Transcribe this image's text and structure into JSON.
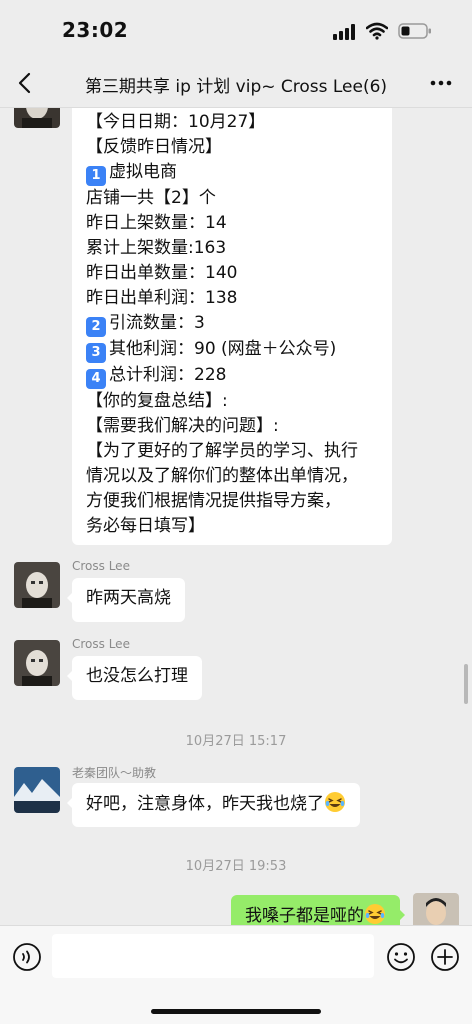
{
  "status_bar": {
    "time": "23:02"
  },
  "header": {
    "title": "第三期共享 ip 计划 vip~ Cross Lee(6)"
  },
  "messages": {
    "m1": {
      "lines": [
        "【今日日期：10月27】",
        "【反馈昨日情况】",
        "虚拟电商",
        "店铺一共【2】个",
        "昨日上架数量：14",
        "累计上架数量:163",
        "昨日出单数量：140",
        "昨日出单利润：138",
        "引流数量：3",
        "其他利润：90 (网盘＋公众号)",
        "总计利润：228",
        "【你的复盘总结】:",
        "【需要我们解决的问题】:",
        "【为了更好的了解学员的学习、执行",
        "情况以及了解你们的整体出单情况，",
        "方便我们根据情况提供指导方案，",
        "务必每日填写】"
      ],
      "badges": [
        "1",
        "2",
        "3",
        "4"
      ]
    },
    "m2": {
      "sender": "Cross Lee",
      "text": "昨两天高烧"
    },
    "m3": {
      "sender": "Cross Lee",
      "text": "也没怎么打理"
    },
    "ts1": "10月27日 15:17",
    "m4": {
      "sender": "老秦团队～助教",
      "text": "好吧，注意身体，昨天我也烧了",
      "emoji": "laughing-face"
    },
    "ts2": "10月27日 19:53",
    "m5": {
      "text": "我嗓子都是哑的",
      "emoji": "laughing-face"
    }
  },
  "input": {
    "placeholder": ""
  },
  "colors": {
    "bubble_self": "#95ec69",
    "bubble_other": "#ffffff",
    "background": "#ededed",
    "badge": "#3b82f6"
  }
}
